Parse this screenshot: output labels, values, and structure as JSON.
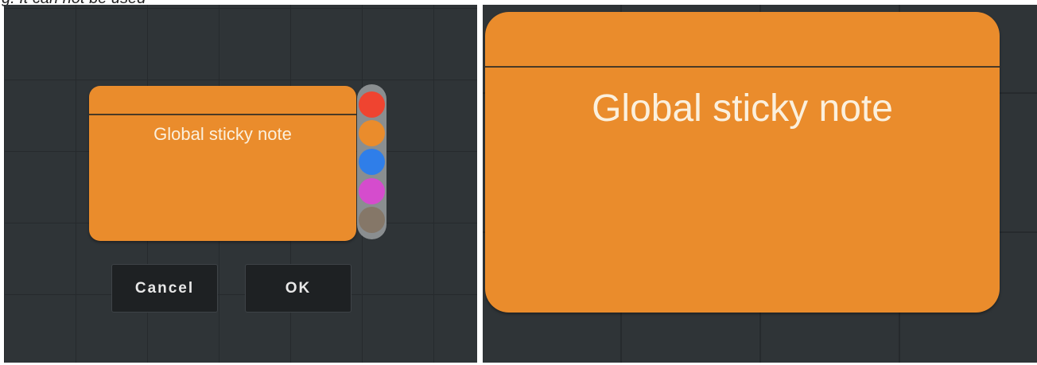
{
  "top_text": "g. It can not be used",
  "left_panel": {
    "note_title": "Global sticky note",
    "colors": {
      "note": "#ea8c2c",
      "swatches": [
        "#ef4430",
        "#ea8c2c",
        "#2f7ee9",
        "#d54ccd",
        "#857768"
      ]
    },
    "swatch_names": [
      "red",
      "orange",
      "blue",
      "magenta",
      "taupe"
    ],
    "buttons": {
      "cancel_label": "Cancel",
      "ok_label": "OK"
    }
  },
  "right_panel": {
    "note_title": "Global sticky note"
  }
}
